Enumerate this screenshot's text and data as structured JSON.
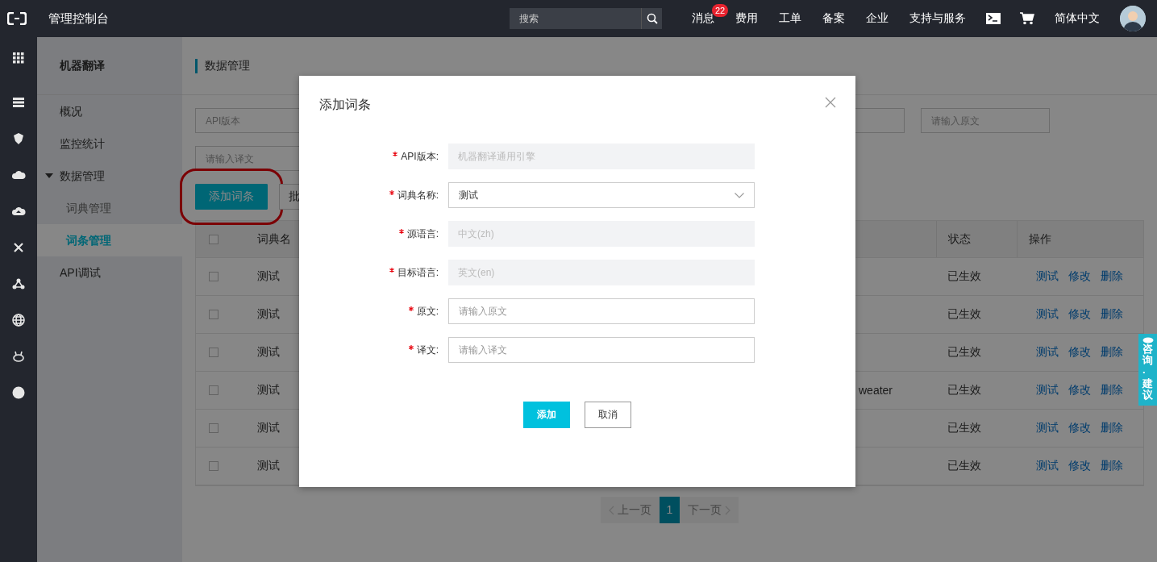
{
  "topbar": {
    "title": "管理控制台",
    "search": {
      "placeholder": "搜索"
    },
    "nav": [
      {
        "kind": "text",
        "label": "消息",
        "badge": "22"
      },
      {
        "kind": "text",
        "label": "费用"
      },
      {
        "kind": "text",
        "label": "工单"
      },
      {
        "kind": "text",
        "label": "备案"
      },
      {
        "kind": "text",
        "label": "企业"
      },
      {
        "kind": "text",
        "label": "支持与服务"
      },
      {
        "kind": "terminal"
      },
      {
        "kind": "cart"
      },
      {
        "kind": "text",
        "label": "简体中文"
      },
      {
        "kind": "avatar"
      }
    ]
  },
  "sidebar": {
    "title": "机器翻译",
    "items": [
      {
        "label": "概况",
        "selected": false
      },
      {
        "label": "监控统计",
        "selected": false
      },
      {
        "label": "数据管理",
        "selected": false,
        "expanded": true,
        "children": [
          {
            "label": "词典管理",
            "selected": false
          },
          {
            "label": "词条管理",
            "selected": true
          }
        ]
      },
      {
        "label": "API调试",
        "selected": false
      }
    ]
  },
  "page": {
    "title": "数据管理",
    "filters": [
      {
        "placeholder": "API版本"
      },
      {
        "placeholder": "请输入原文"
      },
      {
        "placeholder": "请输入译文"
      }
    ],
    "buttons": [
      {
        "label": "添加词条",
        "highlighted": true
      },
      {
        "label": "批"
      }
    ],
    "table": {
      "columns": [
        "词典名",
        "状态",
        "操作"
      ],
      "header_checked": false,
      "rows": [
        {
          "checked": false,
          "name": "测试",
          "status": "已生效",
          "actions": [
            "测试",
            "修改",
            "删除"
          ]
        },
        {
          "checked": false,
          "name": "测试",
          "status": "已生效",
          "actions": [
            "测试",
            "修改",
            "删除"
          ]
        },
        {
          "checked": false,
          "name": "测试",
          "status": "已生效",
          "actions": [
            "测试",
            "修改",
            "删除"
          ]
        },
        {
          "checked": false,
          "name": "测试",
          "column_3": "weater",
          "status": "已生效",
          "actions": [
            "测试",
            "修改",
            "删除"
          ]
        },
        {
          "checked": false,
          "name": "测试",
          "status": "已生效",
          "actions": [
            "测试",
            "修改",
            "删除"
          ]
        },
        {
          "checked": false,
          "name": "测试",
          "status": "已生效",
          "actions": [
            "测试",
            "修改",
            "删除"
          ]
        }
      ]
    },
    "pagination": {
      "prev": "上一页",
      "pages": [
        {
          "label": "1",
          "selected": true
        }
      ],
      "next": "下一页"
    }
  },
  "feedback_tab": "咨询·建议",
  "dialog": {
    "title": "添加词条",
    "fields": [
      {
        "label": "API版本:",
        "required": true,
        "kind": "readonly",
        "value": "机器翻译通用引擎"
      },
      {
        "label": "词典名称:",
        "required": true,
        "kind": "select",
        "value": "测试"
      },
      {
        "label": "源语言:",
        "required": true,
        "kind": "readonly",
        "value": "中文(zh)"
      },
      {
        "label": "目标语言:",
        "required": true,
        "kind": "readonly",
        "value": "英文(en)"
      },
      {
        "label": "原文:",
        "required": true,
        "kind": "input",
        "placeholder": "请输入原文"
      },
      {
        "label": "译文:",
        "required": true,
        "kind": "input",
        "placeholder": "请输入译文"
      }
    ],
    "buttons": [
      {
        "label": "添加",
        "kind": "primary"
      },
      {
        "label": "取消",
        "kind": "secondary"
      }
    ]
  }
}
